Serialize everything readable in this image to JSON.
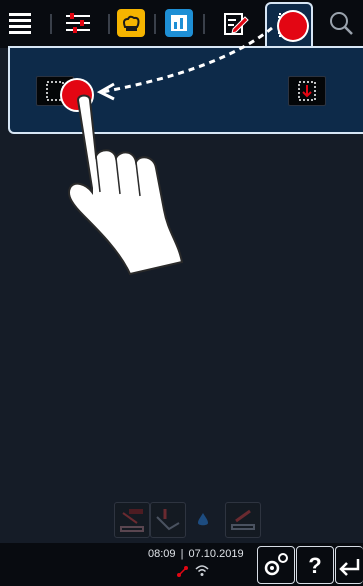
{
  "topbar": {
    "icons": [
      "menu-icon",
      "filter-sliders-icon",
      "chef-hat-icon",
      "book-icon",
      "edit-icon",
      "tray-icon",
      "search-icon"
    ],
    "accent_yellow": "#f5b400",
    "accent_blue": "#1e8fd5",
    "active_tab": "tray-icon"
  },
  "panel": {
    "left_button": "tray-outline-icon",
    "right_button": "tray-down-arrow-icon",
    "bg": "#0d2a49"
  },
  "gesture": {
    "hint": "drag-left",
    "marker_color": "#e30613"
  },
  "footer_icons": [
    "auto-door-icon",
    "door-steam-icon",
    "water-drop-icon",
    "tray-arrow-icon"
  ],
  "status": {
    "time": "08:09",
    "separator": "|",
    "date": "07.10.2019"
  },
  "status_icons": [
    "connection-icon",
    "wifi-icon"
  ],
  "buttons": {
    "settings": "gear-icon",
    "help_label": "?",
    "back": "back-arrow-icon"
  }
}
